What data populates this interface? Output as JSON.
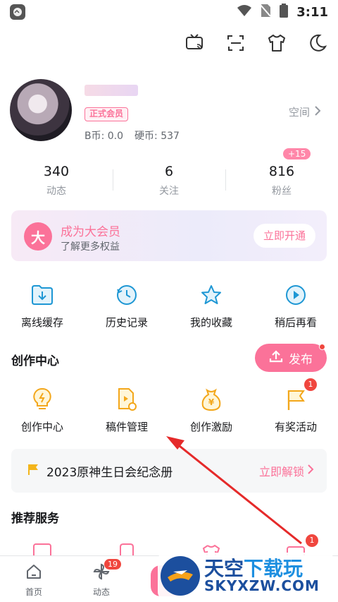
{
  "status_bar": {
    "time": "3:11"
  },
  "profile": {
    "vip_badge": "正式会员",
    "bcoin": "B币: 0.0",
    "coin": "硬币: 537",
    "space_link": "空间"
  },
  "stats": [
    {
      "num": "340",
      "label": "动态",
      "badge": ""
    },
    {
      "num": "6",
      "label": "关注",
      "badge": ""
    },
    {
      "num": "816",
      "label": "粉丝",
      "badge": "+15"
    }
  ],
  "vip_banner": {
    "icon_text": "大",
    "title": "成为大会员",
    "subtitle": "了解更多权益",
    "button": "立即开通"
  },
  "quick_actions": [
    {
      "label": "离线缓存",
      "icon": "download-folder-icon"
    },
    {
      "label": "历史记录",
      "icon": "history-clock-icon"
    },
    {
      "label": "我的收藏",
      "icon": "star-icon"
    },
    {
      "label": "稍后再看",
      "icon": "watch-later-icon"
    }
  ],
  "creation": {
    "title": "创作中心",
    "publish_button": "发布",
    "items": [
      {
        "label": "创作中心",
        "icon": "lightbulb-icon",
        "badge": ""
      },
      {
        "label": "稿件管理",
        "icon": "manuscript-icon",
        "badge": ""
      },
      {
        "label": "创作激励",
        "icon": "money-bag-icon",
        "badge": ""
      },
      {
        "label": "有奖活动",
        "icon": "flag-icon",
        "badge": "1"
      }
    ]
  },
  "unlock_bar": {
    "text": "2023原神生日会纪念册",
    "action": "立即解锁"
  },
  "recommend": {
    "title": "推荐服务",
    "service_badge": "1",
    "service_icons": [
      "course-icon",
      "shop-icon",
      "clothing-icon",
      "game-icon"
    ]
  },
  "tabbar": {
    "tabs": [
      {
        "label": "首页",
        "icon": "home-icon"
      },
      {
        "label": "动态",
        "icon": "pinwheel-icon",
        "badge": "19"
      }
    ]
  },
  "watermark": {
    "main_a": "天空",
    "main_b": "下载玩",
    "url": "SKYXZW.COM"
  },
  "colors": {
    "accent": "#fb7299",
    "badge": "#f0463e",
    "text": "#18191c",
    "muted": "#9499a0"
  }
}
